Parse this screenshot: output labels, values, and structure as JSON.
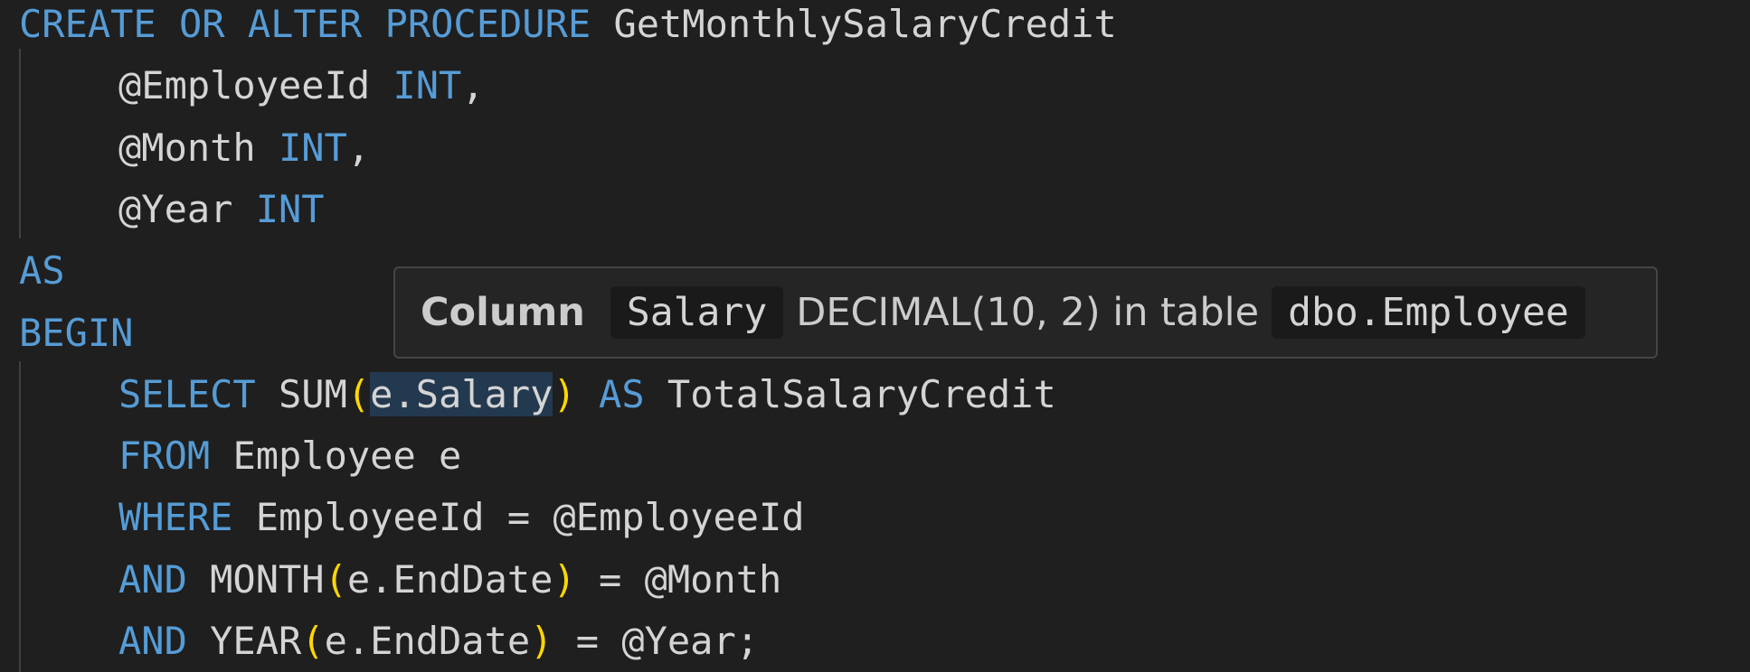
{
  "editor": {
    "lines": [
      {
        "tokens": [
          {
            "t": "CREATE OR ALTER PROCEDURE",
            "c": "kw"
          },
          {
            "t": " GetMonthlySalaryCredit",
            "c": "id"
          }
        ]
      },
      {
        "indent": true,
        "tokens": [
          {
            "t": "@EmployeeId",
            "c": "id"
          },
          {
            "t": " INT",
            "c": "kw"
          },
          {
            "t": ",",
            "c": "op"
          }
        ]
      },
      {
        "indent": true,
        "tokens": [
          {
            "t": "@Month",
            "c": "id"
          },
          {
            "t": " INT",
            "c": "kw"
          },
          {
            "t": ",",
            "c": "op"
          }
        ]
      },
      {
        "indent": true,
        "tokens": [
          {
            "t": "@Year",
            "c": "id"
          },
          {
            "t": " INT",
            "c": "kw"
          }
        ]
      },
      {
        "tokens": [
          {
            "t": "AS",
            "c": "kw"
          }
        ]
      },
      {
        "tokens": [
          {
            "t": "BEGIN",
            "c": "kw"
          }
        ]
      },
      {
        "indent": true,
        "tokens": [
          {
            "t": "SELECT",
            "c": "kw"
          },
          {
            "t": " SUM",
            "c": "id"
          },
          {
            "t": "(",
            "c": "paren"
          },
          {
            "t": "e.Salary",
            "c": "id hl"
          },
          {
            "t": ")",
            "c": "paren"
          },
          {
            "t": " AS",
            "c": "kw"
          },
          {
            "t": " TotalSalaryCredit",
            "c": "id"
          }
        ]
      },
      {
        "indent": true,
        "tokens": [
          {
            "t": "FROM",
            "c": "kw"
          },
          {
            "t": " Employee e",
            "c": "id"
          }
        ]
      },
      {
        "indent": true,
        "tokens": [
          {
            "t": "WHERE",
            "c": "kw"
          },
          {
            "t": " EmployeeId = @EmployeeId",
            "c": "id"
          }
        ]
      },
      {
        "indent": true,
        "tokens": [
          {
            "t": "AND",
            "c": "kw"
          },
          {
            "t": " MONTH",
            "c": "id"
          },
          {
            "t": "(",
            "c": "paren"
          },
          {
            "t": "e.EndDate",
            "c": "id"
          },
          {
            "t": ")",
            "c": "paren"
          },
          {
            "t": " = @Month",
            "c": "id"
          }
        ]
      },
      {
        "indent": true,
        "tokens": [
          {
            "t": "AND",
            "c": "kw"
          },
          {
            "t": " YEAR",
            "c": "id"
          },
          {
            "t": "(",
            "c": "paren"
          },
          {
            "t": "e.EndDate",
            "c": "id"
          },
          {
            "t": ")",
            "c": "paren"
          },
          {
            "t": " = @Year;",
            "c": "id"
          }
        ]
      }
    ]
  },
  "hover": {
    "heading": "Column",
    "column_name": "Salary",
    "type_text": "DECIMAL(10, 2) in table",
    "table_name": "dbo.Employee"
  },
  "colors": {
    "keyword": "#569cd6",
    "identifier": "#d4d4d4",
    "bracket": "#ffd700",
    "background": "#1f1f1f"
  }
}
